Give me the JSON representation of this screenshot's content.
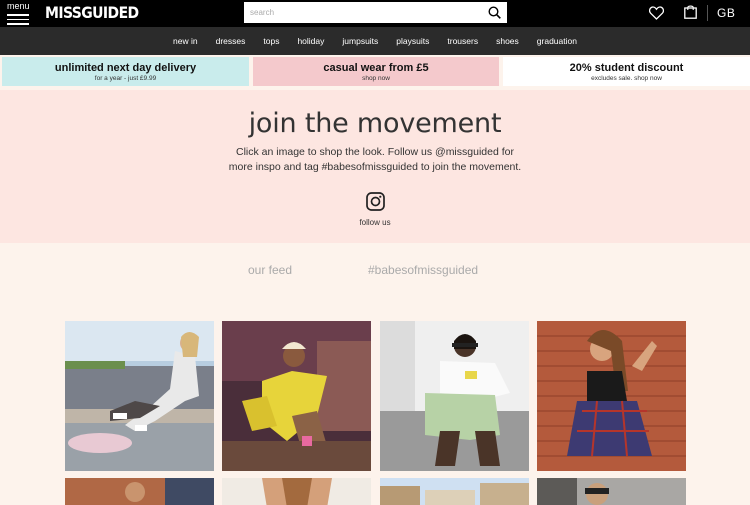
{
  "header": {
    "menu_label": "menu",
    "logo": "MISSGUIDED",
    "search_placeholder": "search",
    "region": "GB"
  },
  "nav": [
    "new in",
    "dresses",
    "tops",
    "holiday",
    "jumpsuits",
    "playsuits",
    "trousers",
    "shoes",
    "graduation"
  ],
  "promos": [
    {
      "title": "unlimited next day delivery",
      "sub": "for a year - just £9.99",
      "color": "#c9ecec"
    },
    {
      "title": "casual wear from £5",
      "sub": "shop now",
      "color": "#f4c9cc"
    },
    {
      "title": "20% student discount",
      "sub": "excludes sale. shop now",
      "color": "#ffffff"
    }
  ],
  "hero": {
    "title": "join the movement",
    "line1": "Click an image to shop the look. Follow us @missguided for",
    "line2": "more inspo and tag #babesofmissguided to join the movement.",
    "follow": "follow us"
  },
  "tabs": [
    "our feed",
    "#babesofmissguided"
  ],
  "colors": {
    "topbar": "#000000",
    "nav": "#2b2b2b",
    "hero_bg": "#fde6e1",
    "page_bg": "#fdf3ec"
  }
}
